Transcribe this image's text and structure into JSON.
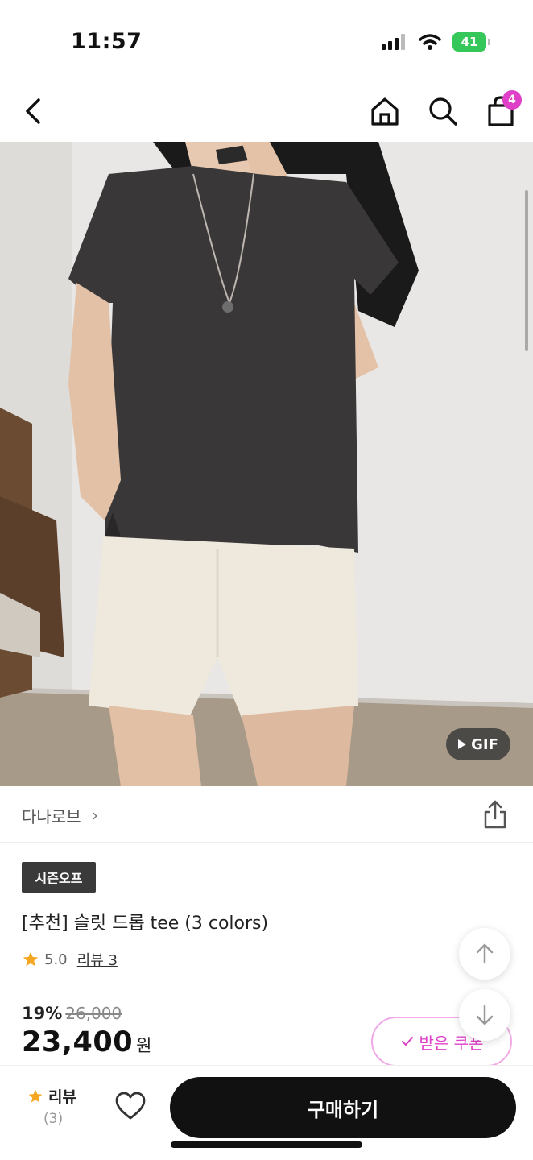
{
  "status_bar": {
    "time": "11:57",
    "battery": "41",
    "icons": [
      "cellular-signal-icon",
      "wifi-icon",
      "battery-charging-icon"
    ]
  },
  "nav": {
    "cart_count": "4",
    "icons": [
      "back-arrow-icon",
      "home-icon",
      "search-icon",
      "shopping-bag-icon"
    ]
  },
  "product_image": {
    "gif_label": "GIF"
  },
  "brand": {
    "name": "다나로브",
    "chevron": "›"
  },
  "product": {
    "badge": "시즌오프",
    "title": "[추천] 슬릿 드롭 tee (3 colors)",
    "rating": "5.0",
    "review_link": "리뷰 3",
    "discount_rate": "19%",
    "original_price": "26,000",
    "sale_price": "23,400",
    "currency": "원",
    "coupon_label": "받은 쿠폰"
  },
  "bottom_bar": {
    "review_label": "리뷰",
    "review_count": "(3)",
    "buy_label": "구매하기"
  },
  "colors": {
    "accent": "#e040c8",
    "star": "#f5a623",
    "primary_button": "#111111"
  }
}
